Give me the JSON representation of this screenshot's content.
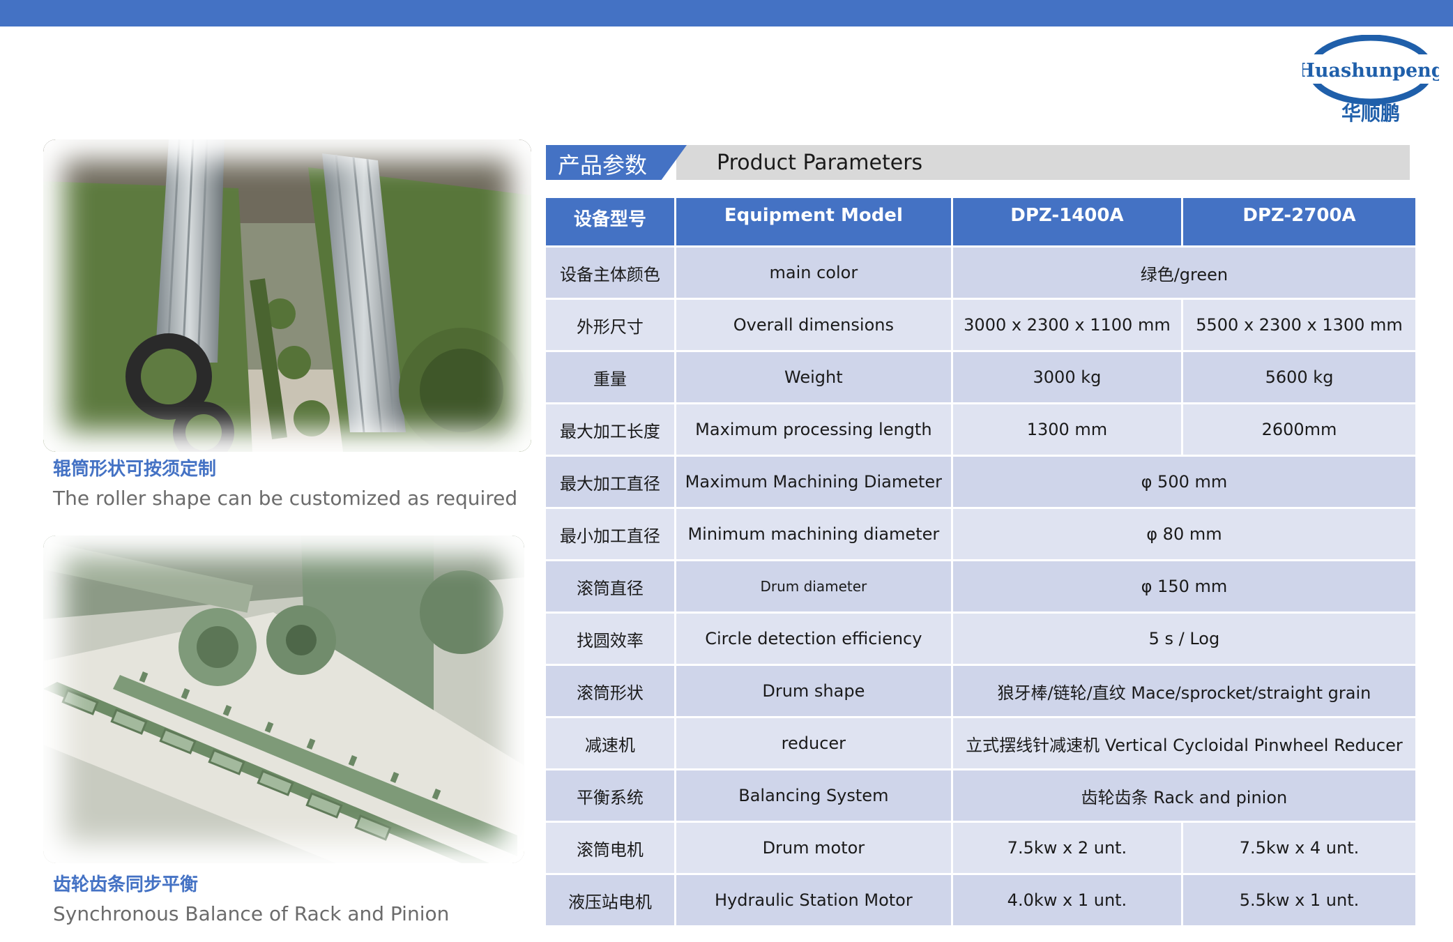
{
  "logo": {
    "text_en": "Huashunpeng",
    "text_cn": "华顺鹏",
    "color": "#1f5faa"
  },
  "colors": {
    "accent": "#4472c4",
    "row_light": "#dfe3f1",
    "row_dark": "#cfd5ea",
    "header_gray": "#d9d9d9"
  },
  "photos": [
    {
      "caption_cn": "辊筒形状可按须定制",
      "caption_en": "The roller shape can be customized as required"
    },
    {
      "caption_cn": "齿轮齿条同步平衡",
      "caption_en": "Synchronous Balance of Rack and Pinion"
    }
  ],
  "section": {
    "title_cn": "产品参数",
    "title_en": "Product Parameters"
  },
  "table": {
    "header": [
      "设备型号",
      "Equipment Model",
      "DPZ-1400A",
      "DPZ-2700A"
    ],
    "rows": [
      {
        "cn": "设备主体颜色",
        "en": "main color",
        "v1": "绿色/green"
      },
      {
        "cn": "外形尺寸",
        "en": "Overall dimensions",
        "v1": "3000 x 2300 x 1100 mm",
        "v2": "5500 x 2300 x 1300 mm"
      },
      {
        "cn": "重量",
        "en": "Weight",
        "v1": "3000 kg",
        "v2": "5600 kg"
      },
      {
        "cn": "最大加工长度",
        "en": "Maximum processing length",
        "v1": "1300 mm",
        "v2": "2600mm"
      },
      {
        "cn": "最大加工直径",
        "en": "Maximum Machining Diameter",
        "v1": "φ 500 mm"
      },
      {
        "cn": "最小加工直径",
        "en": "Minimum machining diameter",
        "v1": "φ 80 mm"
      },
      {
        "cn": "滚筒直径",
        "en": "Drum diameter",
        "v1": "φ 150 mm"
      },
      {
        "cn": "找圆效率",
        "en": "Circle detection efficiency",
        "v1": "5 s / Log"
      },
      {
        "cn": "滚筒形状",
        "en": "Drum shape",
        "v1": "狼牙棒/链轮/直纹 Mace/sprocket/straight grain"
      },
      {
        "cn": "减速机",
        "en": "reducer",
        "v1": "立式摆线针减速机 Vertical Cycloidal Pinwheel Reducer"
      },
      {
        "cn": "平衡系统",
        "en": "Balancing System",
        "v1": "齿轮齿条 Rack and pinion"
      },
      {
        "cn": "滚筒电机",
        "en": "Drum motor",
        "v1": "7.5kw x 2 unt.",
        "v2": "7.5kw x 4 unt."
      },
      {
        "cn": "液压站电机",
        "en": "Hydraulic Station Motor",
        "v1": "4.0kw x 1 unt.",
        "v2": "5.5kw x 1 unt."
      }
    ]
  }
}
